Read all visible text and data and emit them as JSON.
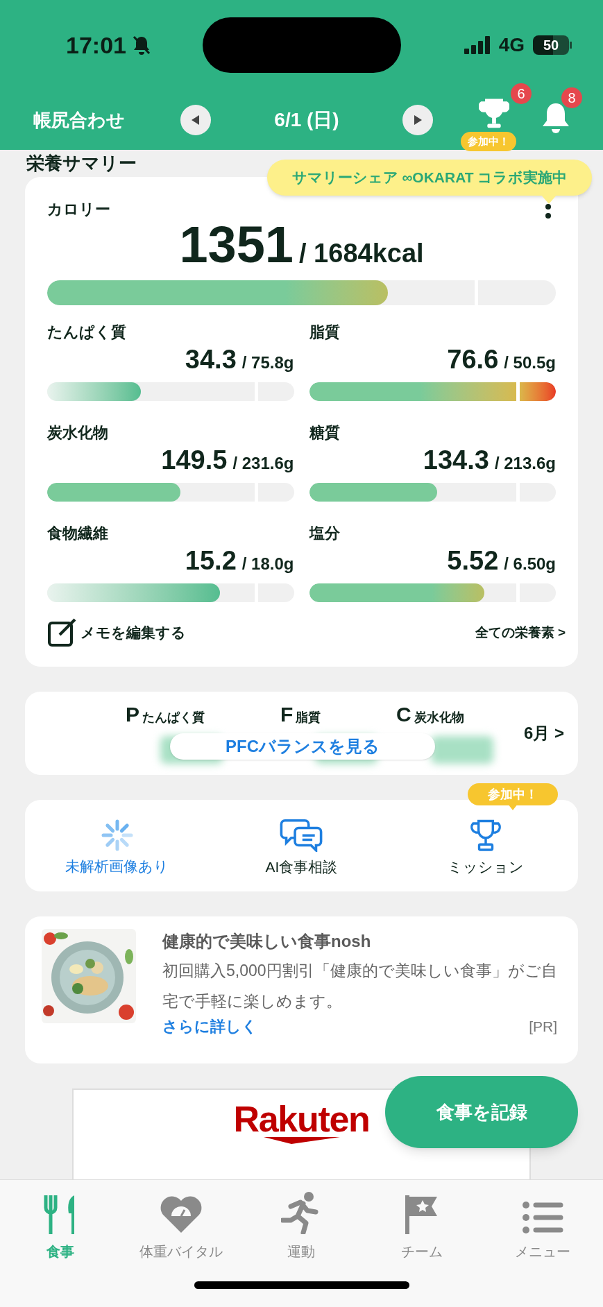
{
  "status_bar": {
    "time": "17:01",
    "network": "4G",
    "battery": "50"
  },
  "header": {
    "title": "帳尻合わせ",
    "date": "6/1 (日)",
    "trophy_badge": "6",
    "trophy_tag": "参加中！",
    "bell_badge": "8"
  },
  "summary": {
    "title": "栄養サマリー",
    "tooltip": "サマリーシェア ∞OKARAT コラボ実施中",
    "calorie": {
      "label": "カロリー",
      "value": "1351",
      "target": "/ 1684kcal",
      "level": 0.67,
      "kind": "warm"
    },
    "nutrients": [
      {
        "label": "たんぱく質",
        "value": "34.3",
        "target": "/ 75.8g",
        "level": 0.38,
        "kind": "fade"
      },
      {
        "label": "脂質",
        "value": "76.6",
        "target": "/ 50.5g",
        "level": 1,
        "kind": "over"
      },
      {
        "label": "炭水化物",
        "value": "149.5",
        "target": "/ 231.6g",
        "level": 0.54,
        "kind": "plain"
      },
      {
        "label": "糖質",
        "value": "134.3",
        "target": "/ 213.6g",
        "level": 0.52,
        "kind": "plain"
      },
      {
        "label": "食物繊維",
        "value": "15.2",
        "target": "/ 18.0g",
        "level": 0.7,
        "kind": "fade"
      },
      {
        "label": "塩分",
        "value": "5.52",
        "target": "/ 6.50g",
        "level": 0.71,
        "kind": "warm"
      }
    ],
    "memo": "メモを編集する",
    "all_link": "全ての栄養素 >"
  },
  "pfc": {
    "labels": [
      {
        "letter": "P",
        "name": "たんぱく質"
      },
      {
        "letter": "F",
        "name": "脂質"
      },
      {
        "letter": "C",
        "name": "炭水化物"
      }
    ],
    "button": "PFCバランスを見る",
    "month_link": "6月 >"
  },
  "actions": [
    {
      "label": "未解析画像あり",
      "kind": "pending"
    },
    {
      "label": "AI食事相談",
      "kind": "chat"
    },
    {
      "label": "ミッション",
      "kind": "trophy",
      "badge": "参加中！"
    }
  ],
  "ad": {
    "title": "健康的で美味しい食事nosh",
    "text": "初回購入5,000円割引「健康的で美味しい食事」がご自宅で手軽に楽しめます。",
    "link": "さらに詳しく",
    "tag": "[PR]"
  },
  "banner": {
    "logo": "Rakuten"
  },
  "fab": "食事を記録",
  "tabs": [
    {
      "label": "食事",
      "kind": "meal",
      "selected": true
    },
    {
      "label": "体重バイタル",
      "kind": "heart",
      "selected": false
    },
    {
      "label": "運動",
      "kind": "run",
      "selected": false
    },
    {
      "label": "チーム",
      "kind": "flag",
      "selected": false
    },
    {
      "label": "メニュー",
      "kind": "menu",
      "selected": false
    }
  ]
}
